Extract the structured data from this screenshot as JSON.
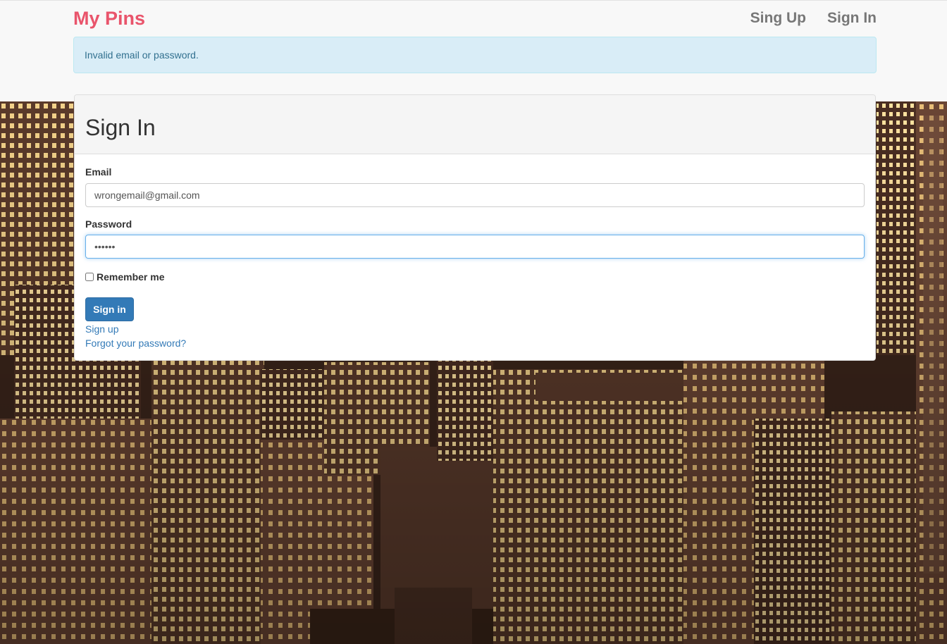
{
  "navbar": {
    "brand": "My Pins",
    "links": [
      "Sing Up",
      "Sign In"
    ]
  },
  "alert": {
    "message": "Invalid email or password."
  },
  "signin_panel": {
    "title": "Sign In",
    "email_label": "Email",
    "email_value": "wrongemail@gmail.com",
    "password_label": "Password",
    "password_value": "••••••",
    "remember_label": "Remember me",
    "submit_label": "Sign in",
    "signup_link": "Sign up",
    "forgot_link": "Forgot your password?"
  },
  "colors": {
    "brand": "#e9546b",
    "alert_bg": "#d9edf7",
    "alert_text": "#31708f",
    "primary": "#337ab7"
  }
}
